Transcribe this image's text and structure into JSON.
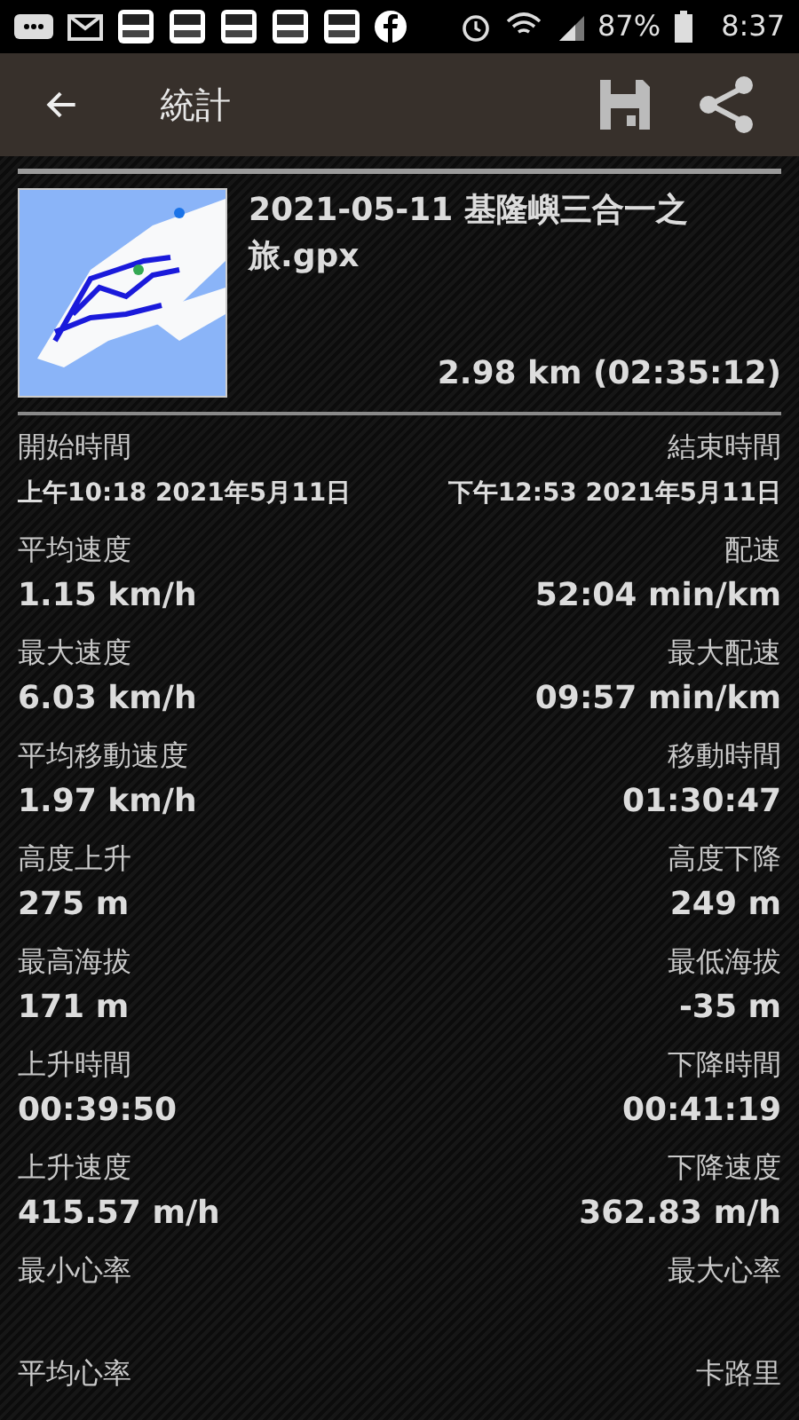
{
  "status_bar": {
    "battery": "87%",
    "time": "8:37"
  },
  "app_bar": {
    "title": "統計"
  },
  "track": {
    "name": "2021-05-11 基隆嶼三合一之旅.gpx",
    "summary": "2.98 km (02:35:12)"
  },
  "time_row": {
    "start_label": "開始時間",
    "end_label": "結束時間",
    "start_value": "上午10:18 2021年5月11日",
    "end_value": "下午12:53 2021年5月11日"
  },
  "stats": [
    {
      "left_label": "平均速度",
      "left_value": "1.15 km/h",
      "right_label": "配速",
      "right_value": "52:04 min/km"
    },
    {
      "left_label": "最大速度",
      "left_value": "6.03 km/h",
      "right_label": "最大配速",
      "right_value": "09:57 min/km"
    },
    {
      "left_label": "平均移動速度",
      "left_value": "1.97 km/h",
      "right_label": "移動時間",
      "right_value": "01:30:47"
    },
    {
      "left_label": "高度上升",
      "left_value": "275 m",
      "right_label": "高度下降",
      "right_value": "249 m"
    },
    {
      "left_label": "最高海拔",
      "left_value": "171 m",
      "right_label": "最低海拔",
      "right_value": "-35 m"
    },
    {
      "left_label": "上升時間",
      "left_value": "00:39:50",
      "right_label": "下降時間",
      "right_value": "00:41:19"
    },
    {
      "left_label": "上升速度",
      "left_value": "415.57 m/h",
      "right_label": "下降速度",
      "right_value": "362.83 m/h"
    },
    {
      "left_label": "最小心率",
      "right_label": "最大心率"
    },
    {
      "left_label": "平均心率",
      "right_label": "卡路里"
    }
  ]
}
